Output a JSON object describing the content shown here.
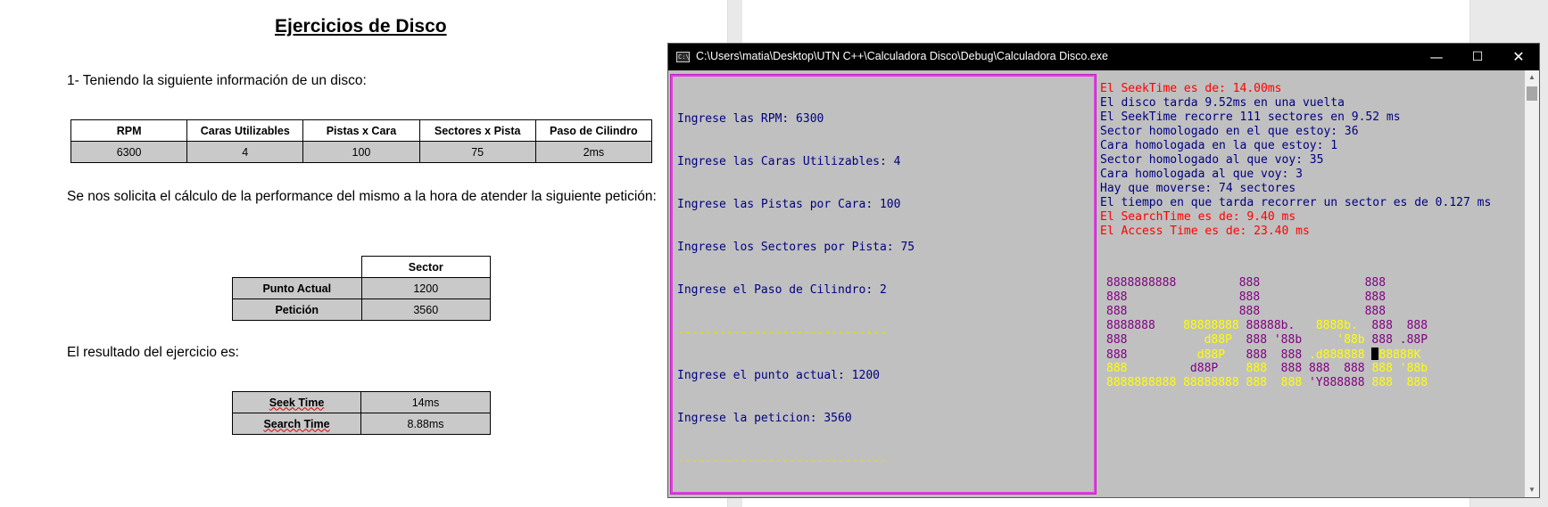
{
  "document": {
    "title": "Ejercicios de Disco",
    "paragraph1": "1- Teniendo la siguiente información de un disco:",
    "disk_table": {
      "headers": [
        "RPM",
        "Caras Utilizables",
        "Pistas x Cara",
        "Sectores x Pista",
        "Paso de Cilindro"
      ],
      "values": [
        "6300",
        "4",
        "100",
        "75",
        "2ms"
      ]
    },
    "paragraph2": "Se nos solicita el cálculo de la performance del mismo a la hora de atender la siguiente petición:",
    "request_table": {
      "header": "Sector",
      "rows": [
        {
          "label": "Punto Actual",
          "value": "1200"
        },
        {
          "label": "Petición",
          "value": "3560"
        }
      ]
    },
    "paragraph3": "El resultado del ejercicio es:",
    "result_table": {
      "rows": [
        {
          "label": "Seek Time",
          "value": "14ms"
        },
        {
          "label": "Search Time",
          "value": "8.88ms"
        }
      ]
    }
  },
  "console": {
    "title": "C:\\Users\\matia\\Desktop\\UTN C++\\Calculadora Disco\\Debug\\Calculadora Disco.exe",
    "icon_text": "C:\\",
    "buttons": {
      "minimize": "—",
      "maximize": "☐",
      "close": "✕"
    },
    "left_lines": [
      "Ingrese las RPM: 6300",
      "Ingrese las Caras Utilizables: 4",
      "Ingrese las Pistas por Cara: 100",
      "Ingrese los Sectores por Pista: 75",
      "Ingrese el Paso de Cilindro: 2",
      "------------------------------",
      "Ingrese el punto actual: 1200",
      "Ingrese la peticion: 3560",
      "------------------------------"
    ],
    "right_lines": [
      "El SeekTime es de: 14.00ms",
      "El disco tarda 9.52ms en una vuelta",
      "El SeekTime recorre 111 sectores en 9.52 ms",
      "Sector homologado en el que estoy: 36",
      "Cara homologada en la que estoy: 1",
      "Sector homologado al que voy: 35",
      "Cara homologada al que voy: 3",
      "Hay que moverse: 74 sectores",
      "El tiempo en que tarda recorrer un sector es de 0.127 ms",
      "El SearchTime es de: 9.40 ms",
      "El Access Time es de: 23.40 ms"
    ],
    "right_line_colors": [
      "red",
      "navy",
      "navy",
      "navy",
      "navy",
      "navy",
      "navy",
      "navy",
      "navy",
      "red",
      "red"
    ],
    "ascii_art": [
      [
        [
          "magenta",
          "8888888888         888               888"
        ]
      ],
      [
        [
          "magenta",
          "888                888               888"
        ]
      ],
      [
        [
          "magenta",
          "888                888               888"
        ]
      ],
      [
        [
          "magenta",
          "8888888    "
        ],
        [
          "yellow",
          "88888888"
        ],
        [
          "magenta",
          " 88888b.   "
        ],
        [
          "yellow",
          "8888b."
        ],
        [
          "magenta",
          "  888  888"
        ]
      ],
      [
        [
          "magenta",
          "888           "
        ],
        [
          "yellow",
          "d88P"
        ],
        [
          "magenta",
          "  888 '88b     "
        ],
        [
          "yellow",
          "'88b"
        ],
        [
          "magenta",
          " 888 .88P"
        ]
      ],
      [
        [
          "magenta",
          "888          "
        ],
        [
          "yellow",
          "d88P"
        ],
        [
          "magenta",
          "   888  888 "
        ],
        [
          "yellow",
          ".d888888"
        ],
        [
          "magenta",
          " "
        ],
        [
          "cursor",
          ""
        ],
        [
          "yellow",
          "88888K"
        ]
      ],
      [
        [
          "yellow",
          "888"
        ],
        [
          "magenta",
          "         d88P    "
        ],
        [
          "yellow",
          "888"
        ],
        [
          "magenta",
          "  888 888  888 "
        ],
        [
          "yellow",
          "888 '88b"
        ]
      ],
      [
        [
          "yellow",
          "8888888888 88888888 888  888"
        ],
        [
          "magenta",
          " 'Y888888 "
        ],
        [
          "yellow",
          "888  888"
        ]
      ]
    ]
  }
}
